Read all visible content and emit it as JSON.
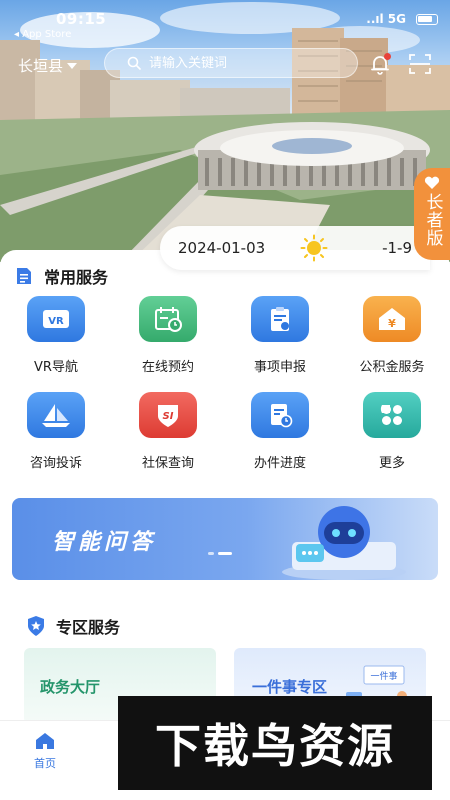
{
  "status": {
    "time": "09:15",
    "back": "◂ App Store",
    "signal": "..ıl 5G"
  },
  "header": {
    "location": "长垣县",
    "search_placeholder": "请输入关键词"
  },
  "elder_mode": {
    "label": "长者版"
  },
  "weather": {
    "date": "2024-01-03",
    "temp": "-1-9"
  },
  "services": {
    "title": "常用服务",
    "items": [
      {
        "label": "VR导航",
        "icon": "vr-icon",
        "color": "#3b86ea"
      },
      {
        "label": "在线预约",
        "icon": "calendar-clock-icon",
        "color": "#43b87c"
      },
      {
        "label": "事项申报",
        "icon": "clipboard-icon",
        "color": "#3b86ea"
      },
      {
        "label": "公积金服务",
        "icon": "house-yuan-icon",
        "color": "#f0982f"
      },
      {
        "label": "咨询投诉",
        "icon": "paper-boat-icon",
        "color": "#3b86ea"
      },
      {
        "label": "社保查询",
        "icon": "social-security-icon",
        "color": "#e9483e"
      },
      {
        "label": "办件进度",
        "icon": "progress-doc-icon",
        "color": "#3b86ea"
      },
      {
        "label": "更多",
        "icon": "four-leaf-icon",
        "color": "#2fb4a8"
      }
    ]
  },
  "banner": {
    "text": "智能问答"
  },
  "zone": {
    "title": "专区服务",
    "cards": [
      {
        "label": "政务大厅"
      },
      {
        "label": "一件事专区",
        "badge": "一件事"
      }
    ]
  },
  "tabbar": {
    "home_label": "首页"
  },
  "watermark": {
    "text": "下载鸟资源"
  }
}
